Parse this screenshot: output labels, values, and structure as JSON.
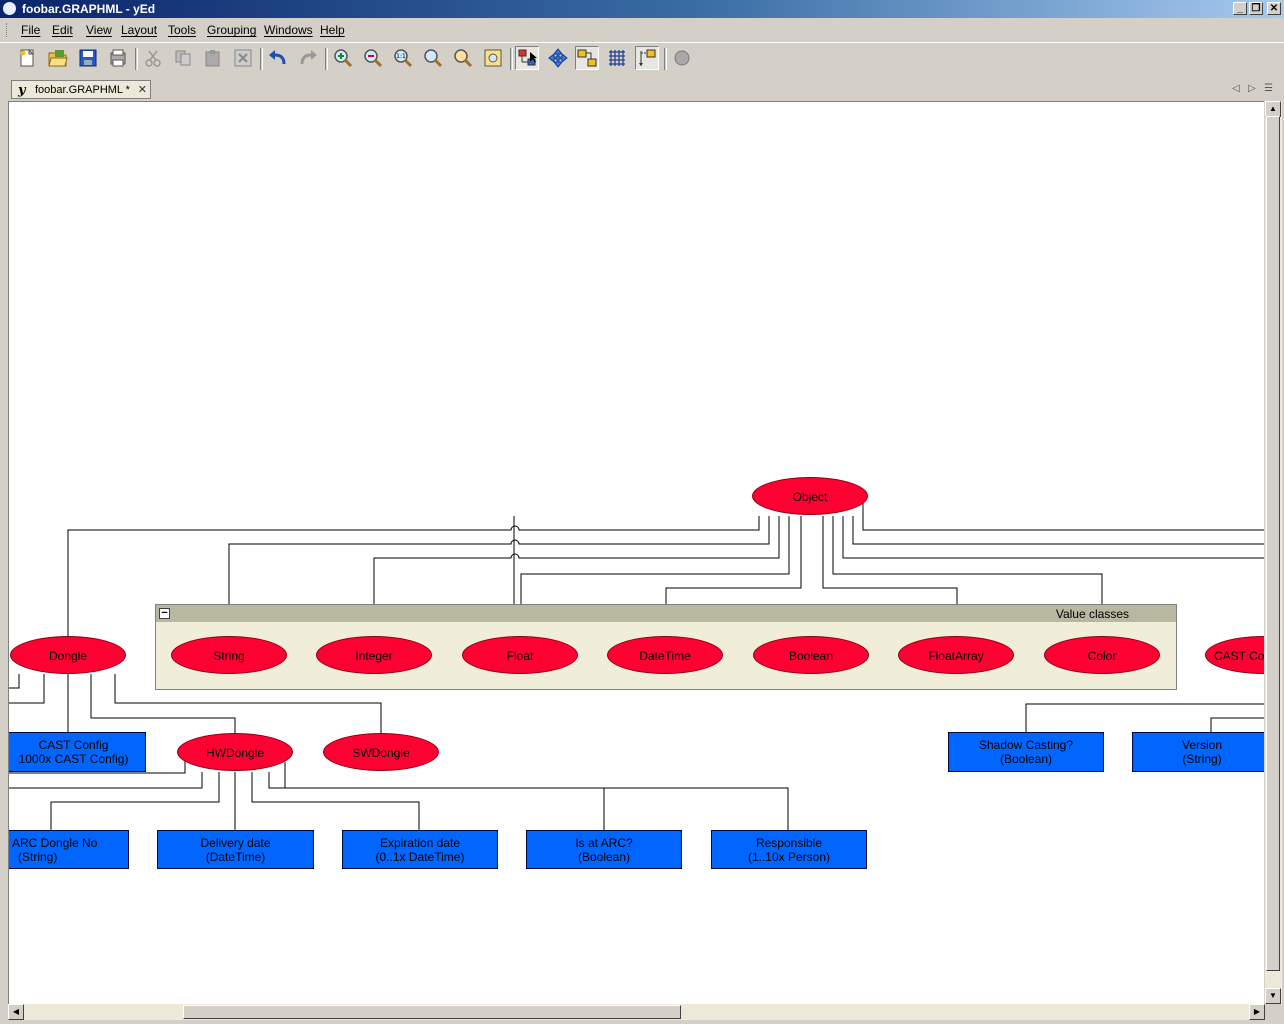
{
  "window": {
    "title": "foobar.GRAPHML - yEd",
    "buttons": [
      "_",
      "❐",
      "✕"
    ]
  },
  "menubar": {
    "items": [
      {
        "key": "file",
        "label": "File"
      },
      {
        "key": "edit",
        "label": "Edit"
      },
      {
        "key": "view",
        "label": "View"
      },
      {
        "key": "layout",
        "label": "Layout"
      },
      {
        "key": "tools",
        "label": "Tools"
      },
      {
        "key": "grouping",
        "label": "Grouping"
      },
      {
        "key": "windows",
        "label": "Windows"
      },
      {
        "key": "help",
        "label": "Help"
      }
    ]
  },
  "toolbar": {
    "icons": [
      "new-document-icon",
      "open-folder-icon",
      "save-icon",
      "export-icon",
      "cut-icon",
      "copy-icon",
      "paste-icon",
      "delete-icon",
      "undo-icon",
      "redo-icon",
      "zoom-in-icon",
      "zoom-out-icon",
      "zoom-actual-size-icon",
      "zoom-area-icon",
      "zoom-selection-icon",
      "fit-content-icon",
      "edit-mode-icon",
      "navigate-mode-icon",
      "orthogonal-edges-icon",
      "grid-icon",
      "snapping-icon",
      "hierarchy-icon"
    ]
  },
  "tab": {
    "icon": "y",
    "label": "foobar.GRAPHML *",
    "close": "✕"
  },
  "graph": {
    "colors": {
      "class_node": "#ff0033",
      "property_node": "#0066ff",
      "group_fill": "#f0eed8",
      "group_header": "#b8b8a0"
    },
    "root": {
      "label": "Object"
    },
    "group": {
      "label": "Value classes",
      "collapse": "−"
    },
    "value_classes": [
      "String",
      "Integer",
      "Float",
      "DateTime",
      "Boolean",
      "FloatArray",
      "Color"
    ],
    "classes": {
      "dongle": "Dongle",
      "hwdongle": "HWDongle",
      "swdongle": "SWDongle",
      "castconfig_cut": "CAST Co"
    },
    "properties": {
      "cast_config": {
        "line1": "CAST Config",
        "line2": "1000x CAST Config)"
      },
      "arc_dongle_no": {
        "line1": "ARC Dongle No",
        "line2": "(String)"
      },
      "delivery_date": {
        "line1": "Delivery date",
        "line2": "(DateTime)"
      },
      "expiration_date": {
        "line1": "Expiration date",
        "line2": "(0..1x DateTime)"
      },
      "is_at_arc": {
        "line1": "Is at ARC?",
        "line2": "(Boolean)"
      },
      "responsible": {
        "line1": "Responsible",
        "line2": "(1..10x Person)"
      },
      "shadow_casting": {
        "line1": "Shadow Casting?",
        "line2": "(Boolean)"
      },
      "version": {
        "line1": "Version",
        "line2": "(String)"
      }
    }
  }
}
